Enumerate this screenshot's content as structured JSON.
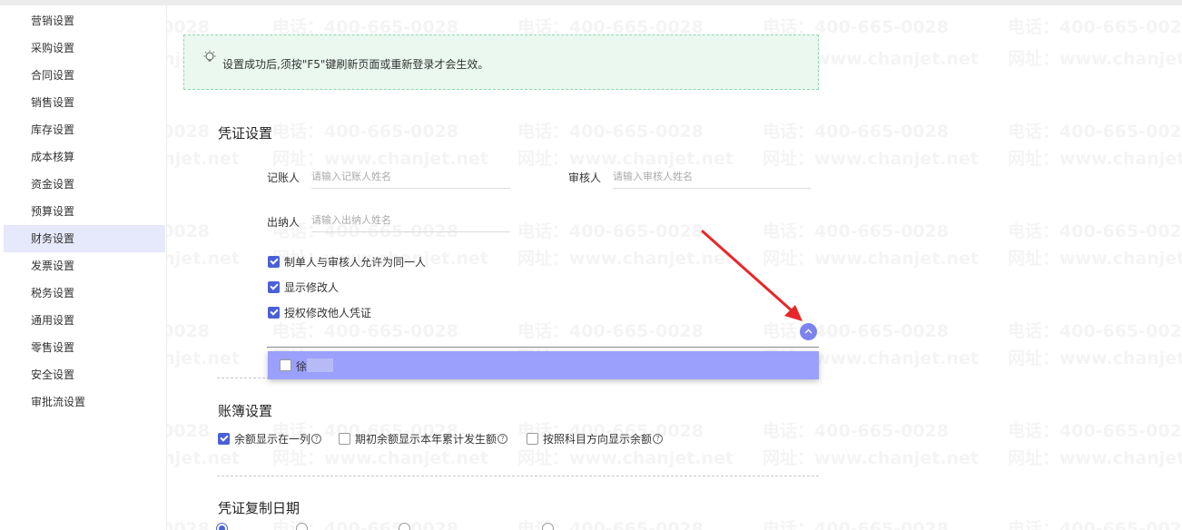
{
  "sidebar": {
    "items": [
      {
        "label": "营销设置"
      },
      {
        "label": "采购设置"
      },
      {
        "label": "合同设置"
      },
      {
        "label": "销售设置"
      },
      {
        "label": "库存设置"
      },
      {
        "label": "成本核算"
      },
      {
        "label": "资金设置"
      },
      {
        "label": "预算设置"
      },
      {
        "label": "财务设置",
        "active": true
      },
      {
        "label": "发票设置"
      },
      {
        "label": "税务设置"
      },
      {
        "label": "通用设置"
      },
      {
        "label": "零售设置"
      },
      {
        "label": "安全设置"
      },
      {
        "label": "审批流设置"
      }
    ]
  },
  "watermark": {
    "phone": "电话：400-665-0028",
    "site": "网址：www.chanjet.net"
  },
  "notice": {
    "text": "设置成功后,须按\"F5\"键刷新页面或重新登录才会生效。"
  },
  "voucher": {
    "title": "凭证设置",
    "bookkeeper_label": "记账人",
    "bookkeeper_placeholder": "请输入记账人姓名",
    "auditor_label": "审核人",
    "auditor_placeholder": "请输入审核人姓名",
    "cashier_label": "出纳人",
    "cashier_placeholder": "请输入出纳人姓名",
    "options": [
      {
        "label": "制单人与审核人允许为同一人",
        "checked": true
      },
      {
        "label": "显示修改人",
        "checked": true
      },
      {
        "label": "授权修改他人凭证",
        "checked": true
      }
    ],
    "dropdown_item": "徐"
  },
  "ledger": {
    "title": "账簿设置",
    "options": [
      {
        "label": "余额显示在一列",
        "checked": true
      },
      {
        "label": "期初余额显示本年累计发生额",
        "checked": false
      },
      {
        "label": "按照科目方向显示余额",
        "checked": false
      }
    ]
  },
  "copy_date": {
    "title": "凭证复制日期"
  },
  "colors": {
    "accent": "#4a60d8",
    "dropdown_bg": "#9aa0fb",
    "notice_bg": "#eaf8f0",
    "annotation_arrow": "#e8262a"
  }
}
